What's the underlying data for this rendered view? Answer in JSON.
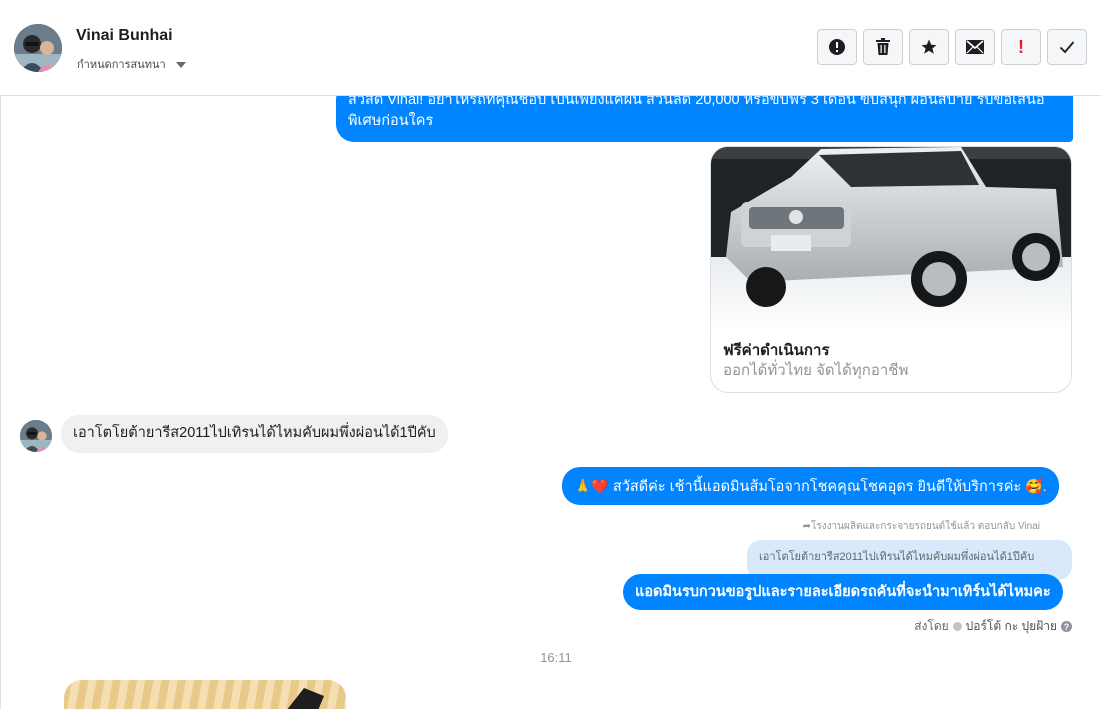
{
  "header": {
    "contact_name": "Vinai Bunhai",
    "assign_label": "กำหนดการสนทนา",
    "toolbar": [
      {
        "name": "spam-button",
        "icon": "alert-circle-icon"
      },
      {
        "name": "delete-button",
        "icon": "trash-icon"
      },
      {
        "name": "star-button",
        "icon": "star-icon"
      },
      {
        "name": "mark-unread-button",
        "icon": "envelope-icon"
      },
      {
        "name": "important-button",
        "icon": "exclamation-icon"
      },
      {
        "name": "done-button",
        "icon": "check-icon"
      }
    ]
  },
  "thread": {
    "msg1_text": "สวัสดี Vinai! อย่าให้รถที่คุณชอบ เป็นเพียงแค่ฝัน ส่วนลด 20,000 หรือขับฟรี 3 เดือน ขับสนุก ผ่อนสบาย รับข้อเสนอพิเศษก่อนใคร",
    "card": {
      "title": "ฟรีค่าดำเนินการ",
      "subtitle": "ออกได้ทั่วไทย จัดได้ทุกอาชีพ"
    },
    "msg2_text": "เอาโตโยต้ายารีส2011ไปเทิรนได้ไหมคับผมพึ่งผ่อนได้1ปีคับ",
    "msg3_text": "สวัสดีค่ะ เช้านี้แอดมินส้มโอจากโชคคุณโชคอุดร ยินดีให้บริการค่ะ",
    "msg3_emoji_left": "🙏❤️",
    "msg3_emoji_right": "🥰.",
    "reply_meta": "โรงงานผลิตและกระจายรถยนต์ใช้แล้ว ตอบกลับ Vinai",
    "quoted_text": "เอาโตโยต้ายารีส2011ไปเทิรนได้ไหมคับผมพึ่งผ่อนได้1ปีคับ",
    "msg4_text": "แอดมินรบกวนขอรูปและรายละเอียดรถคันที่จะนำมาเทิร์นได้ไหมคะ",
    "sent_by_label": "ส่งโดย",
    "sender_name": "ปอร์โต้ กะ ปุยฝ้าย",
    "help_glyph": "?",
    "timestamp": "16:11"
  },
  "colors": {
    "outgoing_bubble": "#0084ff",
    "incoming_bubble": "#f1f0f0",
    "quote_bubble": "#d9e9fb"
  }
}
